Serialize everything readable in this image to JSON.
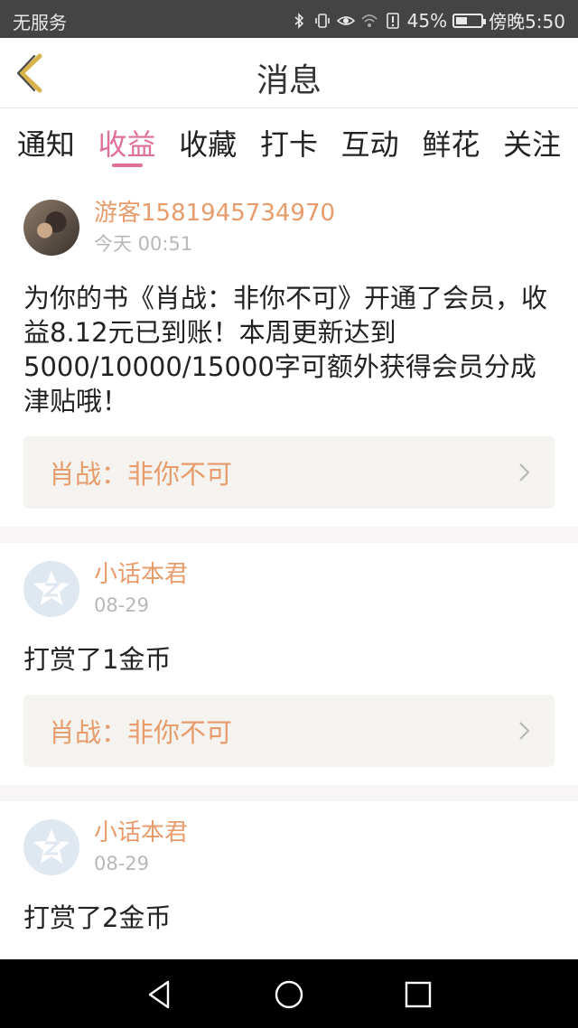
{
  "status_bar": {
    "carrier": "无服务",
    "battery_percent": "45%",
    "battery_level": 0.45,
    "time": "傍晚5:50",
    "icons": [
      "bluetooth-icon",
      "vibrate-icon",
      "eye-icon",
      "wifi-icon",
      "alert-icon",
      "battery-icon"
    ]
  },
  "header": {
    "title": "消息",
    "back_icon": "back-chevron-icon"
  },
  "tabs": [
    {
      "label": "通知",
      "active": false
    },
    {
      "label": "收益",
      "active": true
    },
    {
      "label": "收藏",
      "active": false
    },
    {
      "label": "打卡",
      "active": false
    },
    {
      "label": "互动",
      "active": false
    },
    {
      "label": "鲜花",
      "active": false
    },
    {
      "label": "关注",
      "active": false
    }
  ],
  "messages": [
    {
      "sender": "游客1581945734970",
      "time": "今天 00:51",
      "content": "为你的书《肖战：非你不可》开通了会员，收益8.12元已到账！本周更新达到5000/10000/15000字可额外获得会员分成津贴哦！",
      "book": "肖战：非你不可"
    },
    {
      "sender": "小话本君",
      "time": "08-29",
      "content": "打赏了1金币",
      "book": "肖战：非你不可"
    },
    {
      "sender": "小话本君",
      "time": "08-29",
      "content": "打赏了2金币"
    }
  ],
  "navbar": {
    "icons": [
      "nav-back-icon",
      "nav-home-icon",
      "nav-recents-icon"
    ]
  },
  "colors": {
    "accent": "#e0709a",
    "name": "#e89c6c",
    "status_bar": "#444444"
  }
}
